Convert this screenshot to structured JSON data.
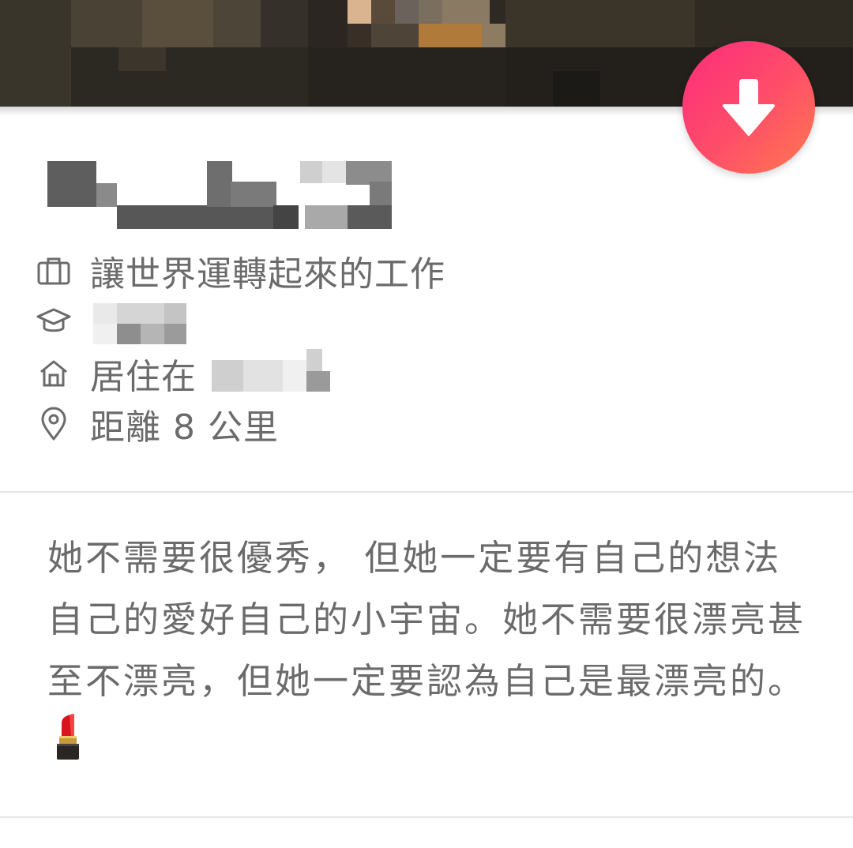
{
  "profile": {
    "job": "讓世界運轉起來的工作",
    "school": "",
    "living_in": "居住在",
    "distance": "距離 8 公里",
    "bio": "她不需要很優秀， 但她一定要有自己的想法自己的愛好自己的小宇宙。她不需要很漂亮甚至不漂亮，但她一定要認為自己是最漂亮的。"
  },
  "icons": {
    "job": "briefcase-icon",
    "school": "graduation-cap-icon",
    "home": "home-icon",
    "location": "location-pin-icon",
    "collapse": "arrow-down-icon",
    "bio_emoji": "lipstick-icon"
  },
  "colors": {
    "accent_start": "#fd2a7c",
    "accent_end": "#ff7a4e",
    "text_secondary": "#6b6b6b"
  }
}
